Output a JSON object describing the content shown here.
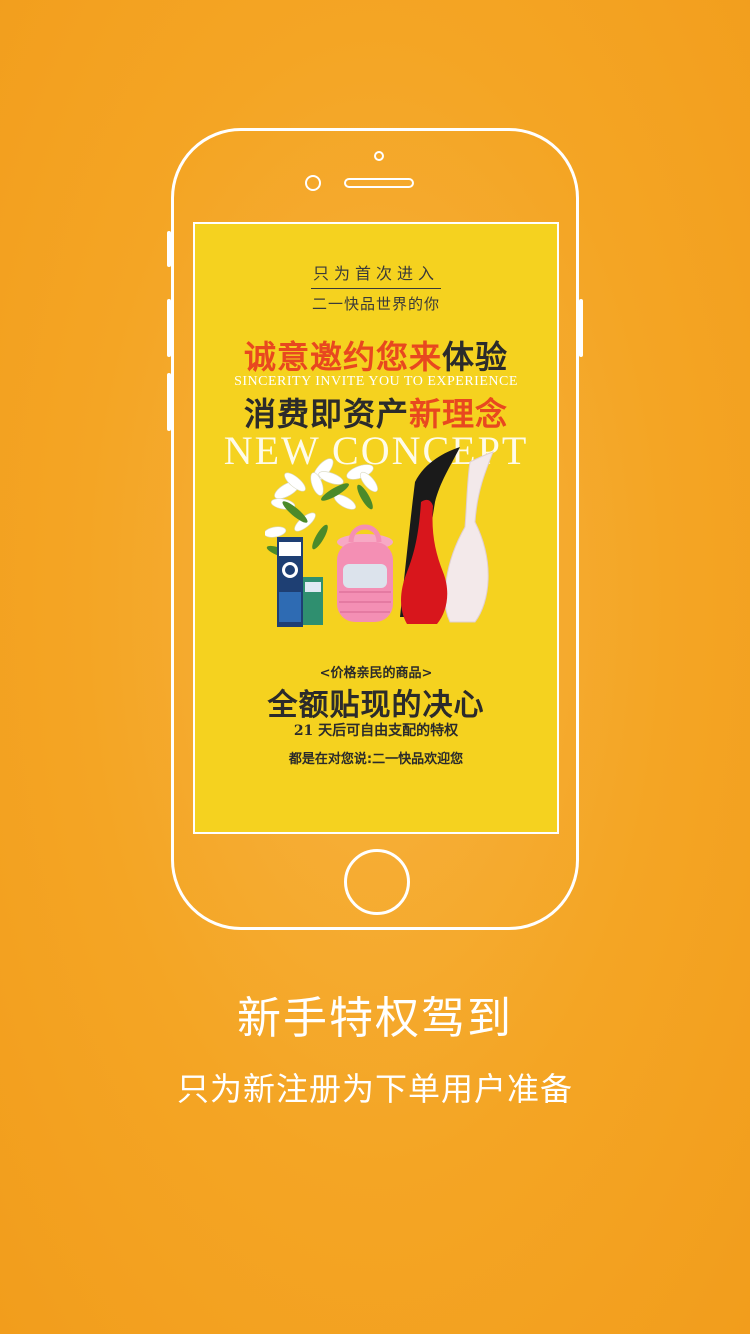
{
  "screen": {
    "intro_line1": "只为首次进入",
    "intro_line2": "二一快品世界的你",
    "headline1_red": "诚意邀约您来",
    "headline1_dark": "体验",
    "headline1_en": "SINCERITY INVITE YOU TO EXPERIENCE",
    "headline2_dark": "消费即资产",
    "headline2_red": "新理念",
    "headline2_en": "NEW CONCEPT",
    "tag": "<价格亲民的商品>",
    "big_text": "全额贴现的决心",
    "sub_text": "21 天后可自由支配的特权",
    "welcome": "都是在对您说:二一快品欢迎您"
  },
  "footer": {
    "title": "新手特权驾到",
    "subtitle": "只为新注册为下单用户准备"
  },
  "colors": {
    "background": "#f4a524",
    "screen": "#f5d21f",
    "accent_red": "#e8481f"
  }
}
